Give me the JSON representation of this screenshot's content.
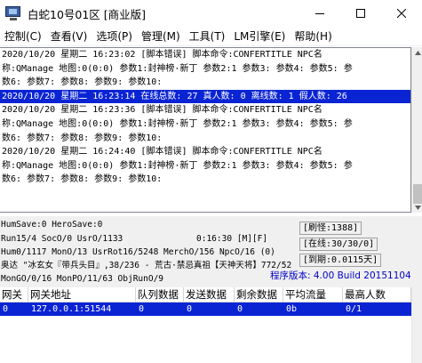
{
  "window": {
    "title": "白蛇10号01区 [商业版]"
  },
  "menu": [
    "控制(C)",
    "查看(V)",
    "选项(P)",
    "管理(M)",
    "工具(T)",
    "LM引擎(E)",
    "帮助(H)"
  ],
  "log_lines": [
    "2020/10/20 星期二 16:23:02 [脚本错误] 脚本命令:CONFERTITLE NPC名",
    "称:QManage 地图:0(0:0) 参数1:封神榜·新丁 参数2:1 参数3: 参数4: 参数5: 参",
    "数6: 参数7: 参数8: 参数9: 参数10:",
    "2020/10/20 星期二 16:23:14 在线总数: 27 真人数: 0 离线数: 1 假人数: 26",
    "2020/10/20 星期二 16:23:36 [脚本错误] 脚本命令:CONFERTITLE NPC名",
    "称:QManage 地图:0(0:0) 参数1:封神榜·新丁 参数2:1 参数3: 参数4: 参数5: 参",
    "数6: 参数7: 参数8: 参数9: 参数10:",
    "2020/10/20 星期二 16:24:40 [脚本错误] 脚本命令:CONFERTITLE NPC名",
    "称:QManage 地图:0(0:0) 参数1:封神榜·新丁 参数2:1 参数3: 参数4: 参数5: 参",
    "数6: 参数7: 参数8: 参数9: 参数10:",
    ""
  ],
  "selected_log_line": 3,
  "status": {
    "line1": "HumSave:0 HeroSave:0",
    "line2": "Run15/4 SocO/0 UsrO/1133",
    "time": "0:16:30 [M][F]",
    "line3": "Hum0/1117 MonO/13 UsrRot16/5248 MerchO/156 NpcO/16 (0)",
    "line4": "奥达 \"冰玄女『带兵头目』,38/236 - 荒古·禁忌真祖【天神天将】772/52",
    "line5": "MonGO/0/16 MonPO/11/63 ObjRunO/9",
    "refresh": "[刷怪:1388]",
    "online": "[在线:30/30/0]",
    "expiry": "[到期:0.0115天]",
    "version": "程序版本: 4.00 Build 20151104"
  },
  "table": {
    "columns": [
      "网关",
      "网关地址",
      "队列数据",
      "发送数据",
      "剩余数据",
      "平均流量",
      "最高人数"
    ],
    "rows": [
      [
        "0",
        "127.0.0.1:51544",
        "0",
        "0",
        "0",
        "0b",
        "0/1"
      ]
    ]
  },
  "colors": {
    "selection": "#0a24d4",
    "version_text": "#0000c8"
  }
}
